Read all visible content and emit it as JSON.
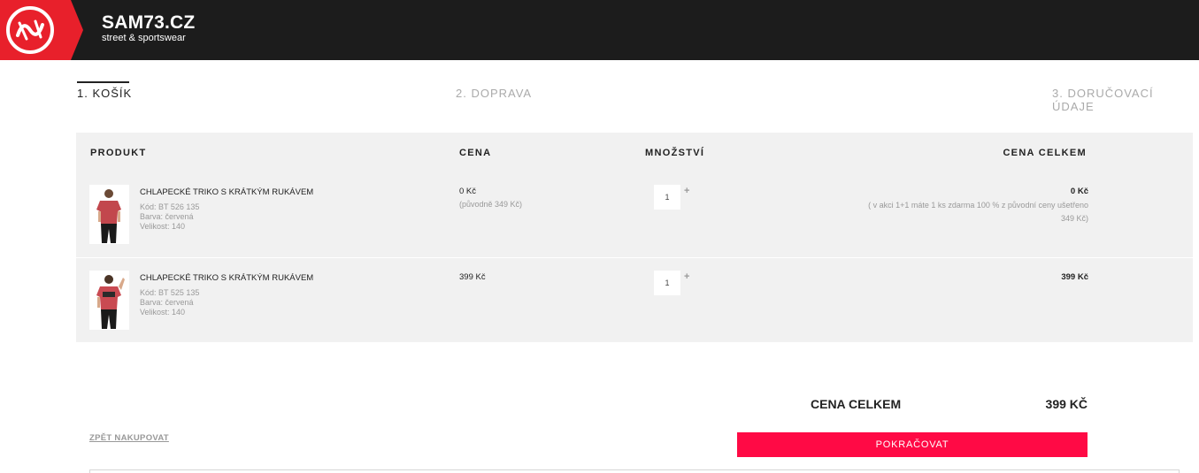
{
  "brand": {
    "title": "SAM73.CZ",
    "subtitle": "street & sportswear",
    "logo_icon": "sam-logo-icon",
    "logo_color": "#e8202b"
  },
  "steps": [
    {
      "label": "1. KOŠÍK",
      "active": true
    },
    {
      "label": "2. DOPRAVA",
      "active": false
    },
    {
      "label": "3. DORUČOVACÍ ÚDAJE",
      "active": false
    }
  ],
  "cart": {
    "columns": {
      "product": "PRODUKT",
      "price": "CENA",
      "quantity": "MNOŽSTVÍ",
      "total": "CENA CELKEM"
    },
    "items": [
      {
        "name": "CHLAPECKÉ TRIKO S KRÁTKÝM RUKÁVEM",
        "code": "Kód: BT 526 135",
        "color": "Barva: červená",
        "size": "Velikost: 140",
        "price": "0 Kč",
        "original_price": "(původně 349 Kč)",
        "quantity": "1",
        "plus": "+",
        "total": "0 Kč",
        "note": "( v akci 1+1 máte 1 ks zdarma 100 % z původní ceny ušetřeno 349 Kč)"
      },
      {
        "name": "CHLAPECKÉ TRIKO S KRÁTKÝM RUKÁVEM",
        "code": "Kód: BT 525 135",
        "color": "Barva: červená",
        "size": "Velikost: 140",
        "price": "399 Kč",
        "quantity": "1",
        "plus": "+",
        "total": "399 Kč"
      }
    ]
  },
  "summary": {
    "label": "CENA CELKEM",
    "value": "399 KČ"
  },
  "actions": {
    "back": "ZPĚT NAKUPOVAT",
    "continue": "POKRAČOVAT",
    "continue_color": "#ff0a45"
  }
}
